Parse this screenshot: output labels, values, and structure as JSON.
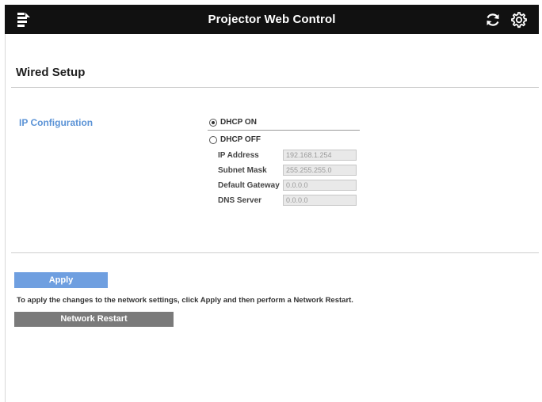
{
  "topbar": {
    "title": "Projector Web Control",
    "menu_icon": "menu-icon",
    "refresh_icon": "refresh-icon",
    "settings_icon": "gear-icon"
  },
  "page": {
    "title": "Wired Setup"
  },
  "ip_config": {
    "label": "IP Configuration",
    "dhcp_on_label": "DHCP ON",
    "dhcp_off_label": "DHCP OFF",
    "selected": "DHCP ON",
    "fields": {
      "ip_address": {
        "label": "IP Address",
        "value": "192.168.1.254"
      },
      "subnet_mask": {
        "label": "Subnet Mask",
        "value": "255.255.255.0"
      },
      "default_gateway": {
        "label": "Default Gateway",
        "value": "0.0.0.0"
      },
      "dns_server": {
        "label": "DNS Server",
        "value": "0.0.0.0"
      }
    }
  },
  "actions": {
    "apply_label": "Apply",
    "hint": "To apply the changes to the network settings, click Apply and then perform a Network Restart.",
    "restart_label": "Network Restart"
  },
  "colors": {
    "topbar_bg": "#111111",
    "accent_blue": "#6f9fe0",
    "section_label_blue": "#5b93d6",
    "restart_gray": "#7a7a7a"
  }
}
